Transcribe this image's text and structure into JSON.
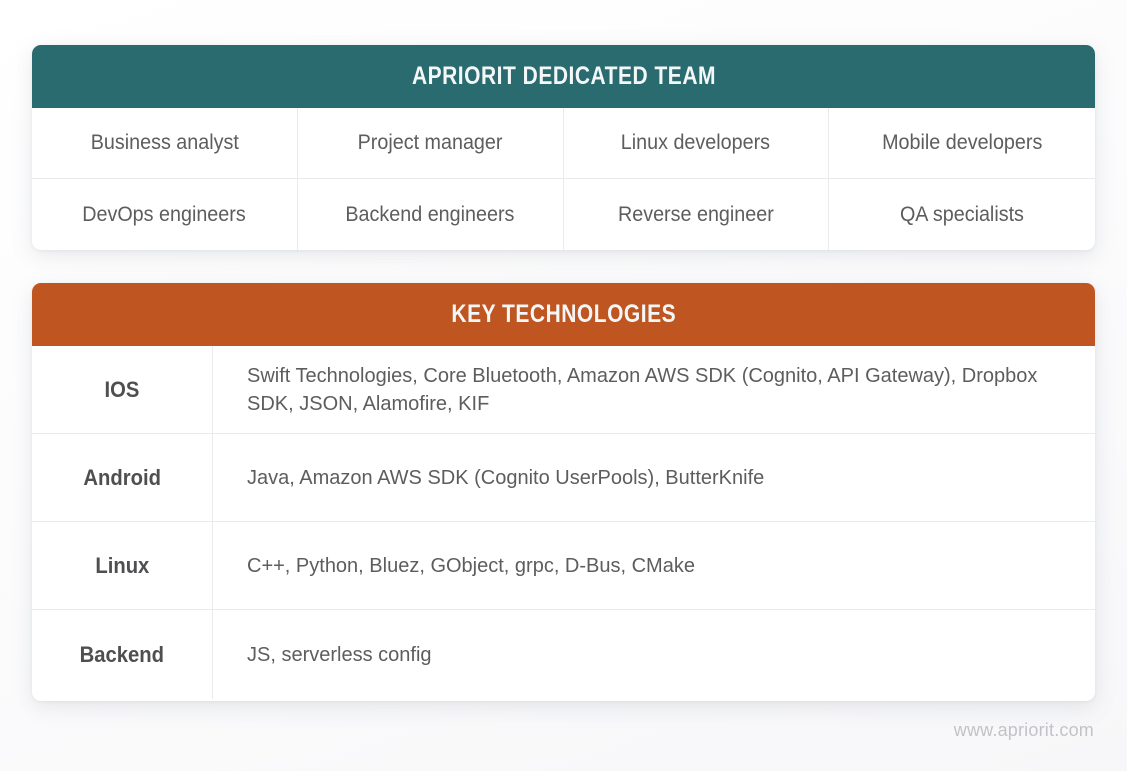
{
  "footer": {
    "watermark": "www.apriorit.com"
  },
  "colors": {
    "team_header_bg": "#2a6b70",
    "tech_header_bg": "#bf5520",
    "header_text": "#f4f7f7",
    "body_text": "#5d5d5f",
    "label_text": "#4f4f51",
    "border": "#eaeaea",
    "watermark_text": "#c3c3c7",
    "page_bg": "#ffffff"
  },
  "team_table": {
    "header": "APRIORIT DEDICATED TEAM",
    "roles": [
      "Business analyst",
      "Project manager",
      "Linux developers",
      "Mobile developers",
      "DevOps engineers",
      "Backend engineers",
      "Reverse engineer",
      "QA specialists"
    ]
  },
  "tech_table": {
    "header": "KEY TECHNOLOGIES",
    "rows": [
      {
        "platform": "IOS",
        "technologies": "Swift Technologies, Core Bluetooth, Amazon AWS SDK (Cognito, API Gateway), Dropbox SDK, JSON, Alamofire, KIF"
      },
      {
        "platform": "Android",
        "technologies": "Java, Amazon AWS SDK (Cognito UserPools), ButterKnife"
      },
      {
        "platform": "Linux",
        "technologies": "C++, Python, Bluez, GObject, grpc, D-Bus, CMake"
      },
      {
        "platform": "Backend",
        "technologies": "JS, serverless config"
      }
    ]
  }
}
